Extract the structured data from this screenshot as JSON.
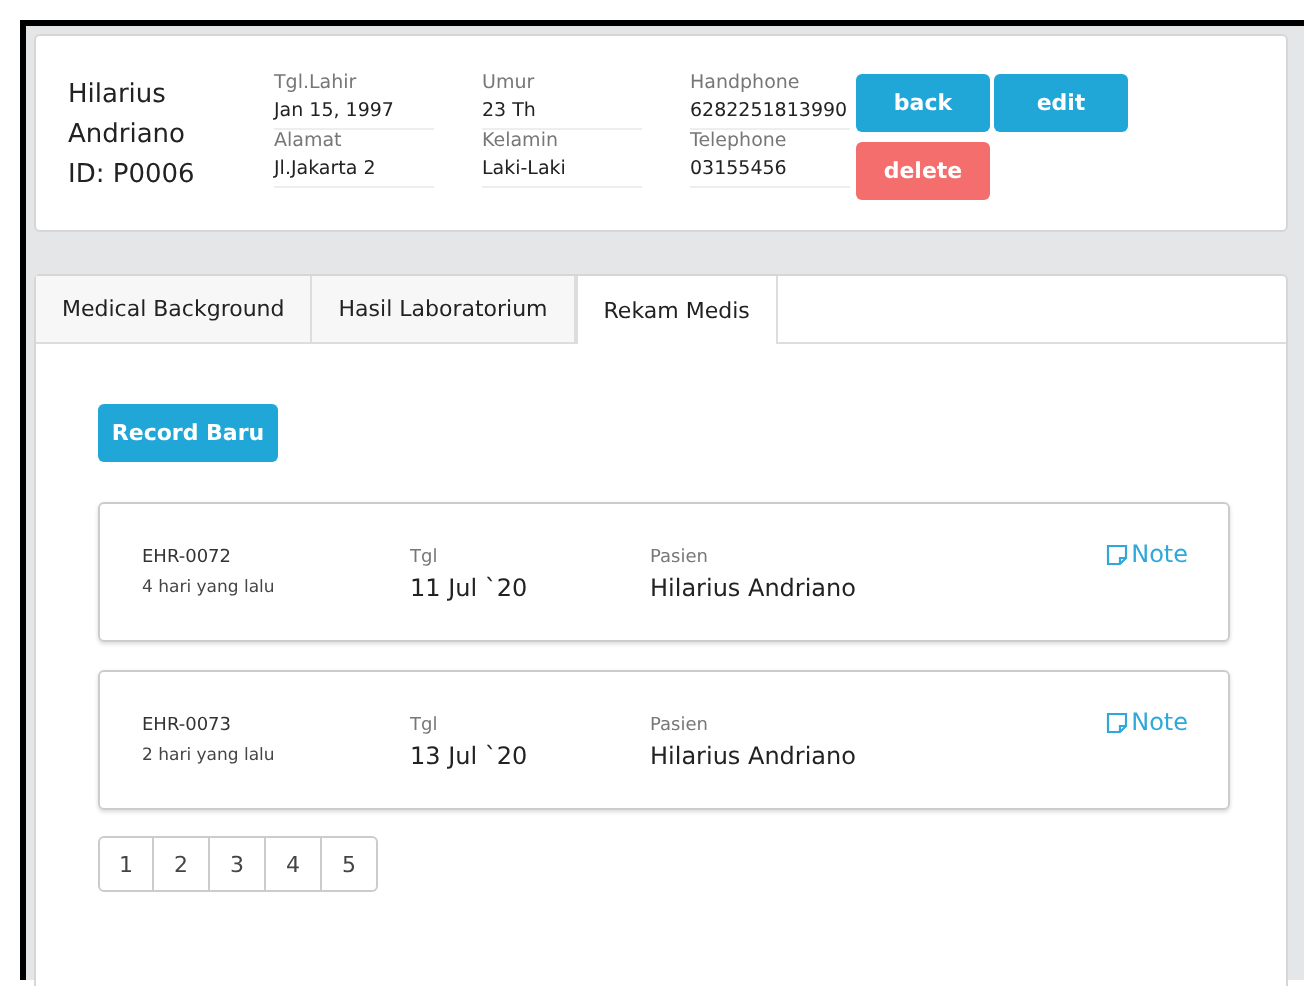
{
  "patient": {
    "name_lines": [
      "Hilarius",
      "Andriano",
      "ID: P0006"
    ]
  },
  "fields": [
    {
      "label": "Tgl.Lahir",
      "value": "Jan 15, 1997"
    },
    {
      "label": "Umur",
      "value": "23 Th"
    },
    {
      "label": "Handphone",
      "value": "6282251813990"
    },
    {
      "label": "Alamat",
      "value": "Jl.Jakarta 2"
    },
    {
      "label": "Kelamin",
      "value": "Laki-Laki"
    },
    {
      "label": "Telephone",
      "value": "03155456"
    }
  ],
  "buttons": [
    {
      "label": "back",
      "kind": "primary"
    },
    {
      "label": "edit",
      "kind": "primary"
    },
    {
      "label": "delete",
      "kind": "danger"
    }
  ],
  "tabs": [
    {
      "label": "Medical Background",
      "selected": false
    },
    {
      "label": "Hasil Laboratorium",
      "selected": false
    },
    {
      "label": "Rekam Medis",
      "selected": true
    }
  ],
  "new_record_button": "Record Baru",
  "records": [
    {
      "id": "EHR-0072",
      "ago": "4 hari yang lalu",
      "date_label": "Tgl",
      "date": "11 Jul `20",
      "patient_label": "Pasien",
      "patient": "Hilarius Andriano",
      "note": "Note"
    },
    {
      "id": "EHR-0073",
      "ago": "2 hari yang lalu",
      "date_label": "Tgl",
      "date": "13 Jul `20",
      "patient_label": "Pasien",
      "patient": "Hilarius Andriano",
      "note": "Note"
    }
  ],
  "pagination": [
    "1",
    "2",
    "3",
    "4",
    "5"
  ]
}
